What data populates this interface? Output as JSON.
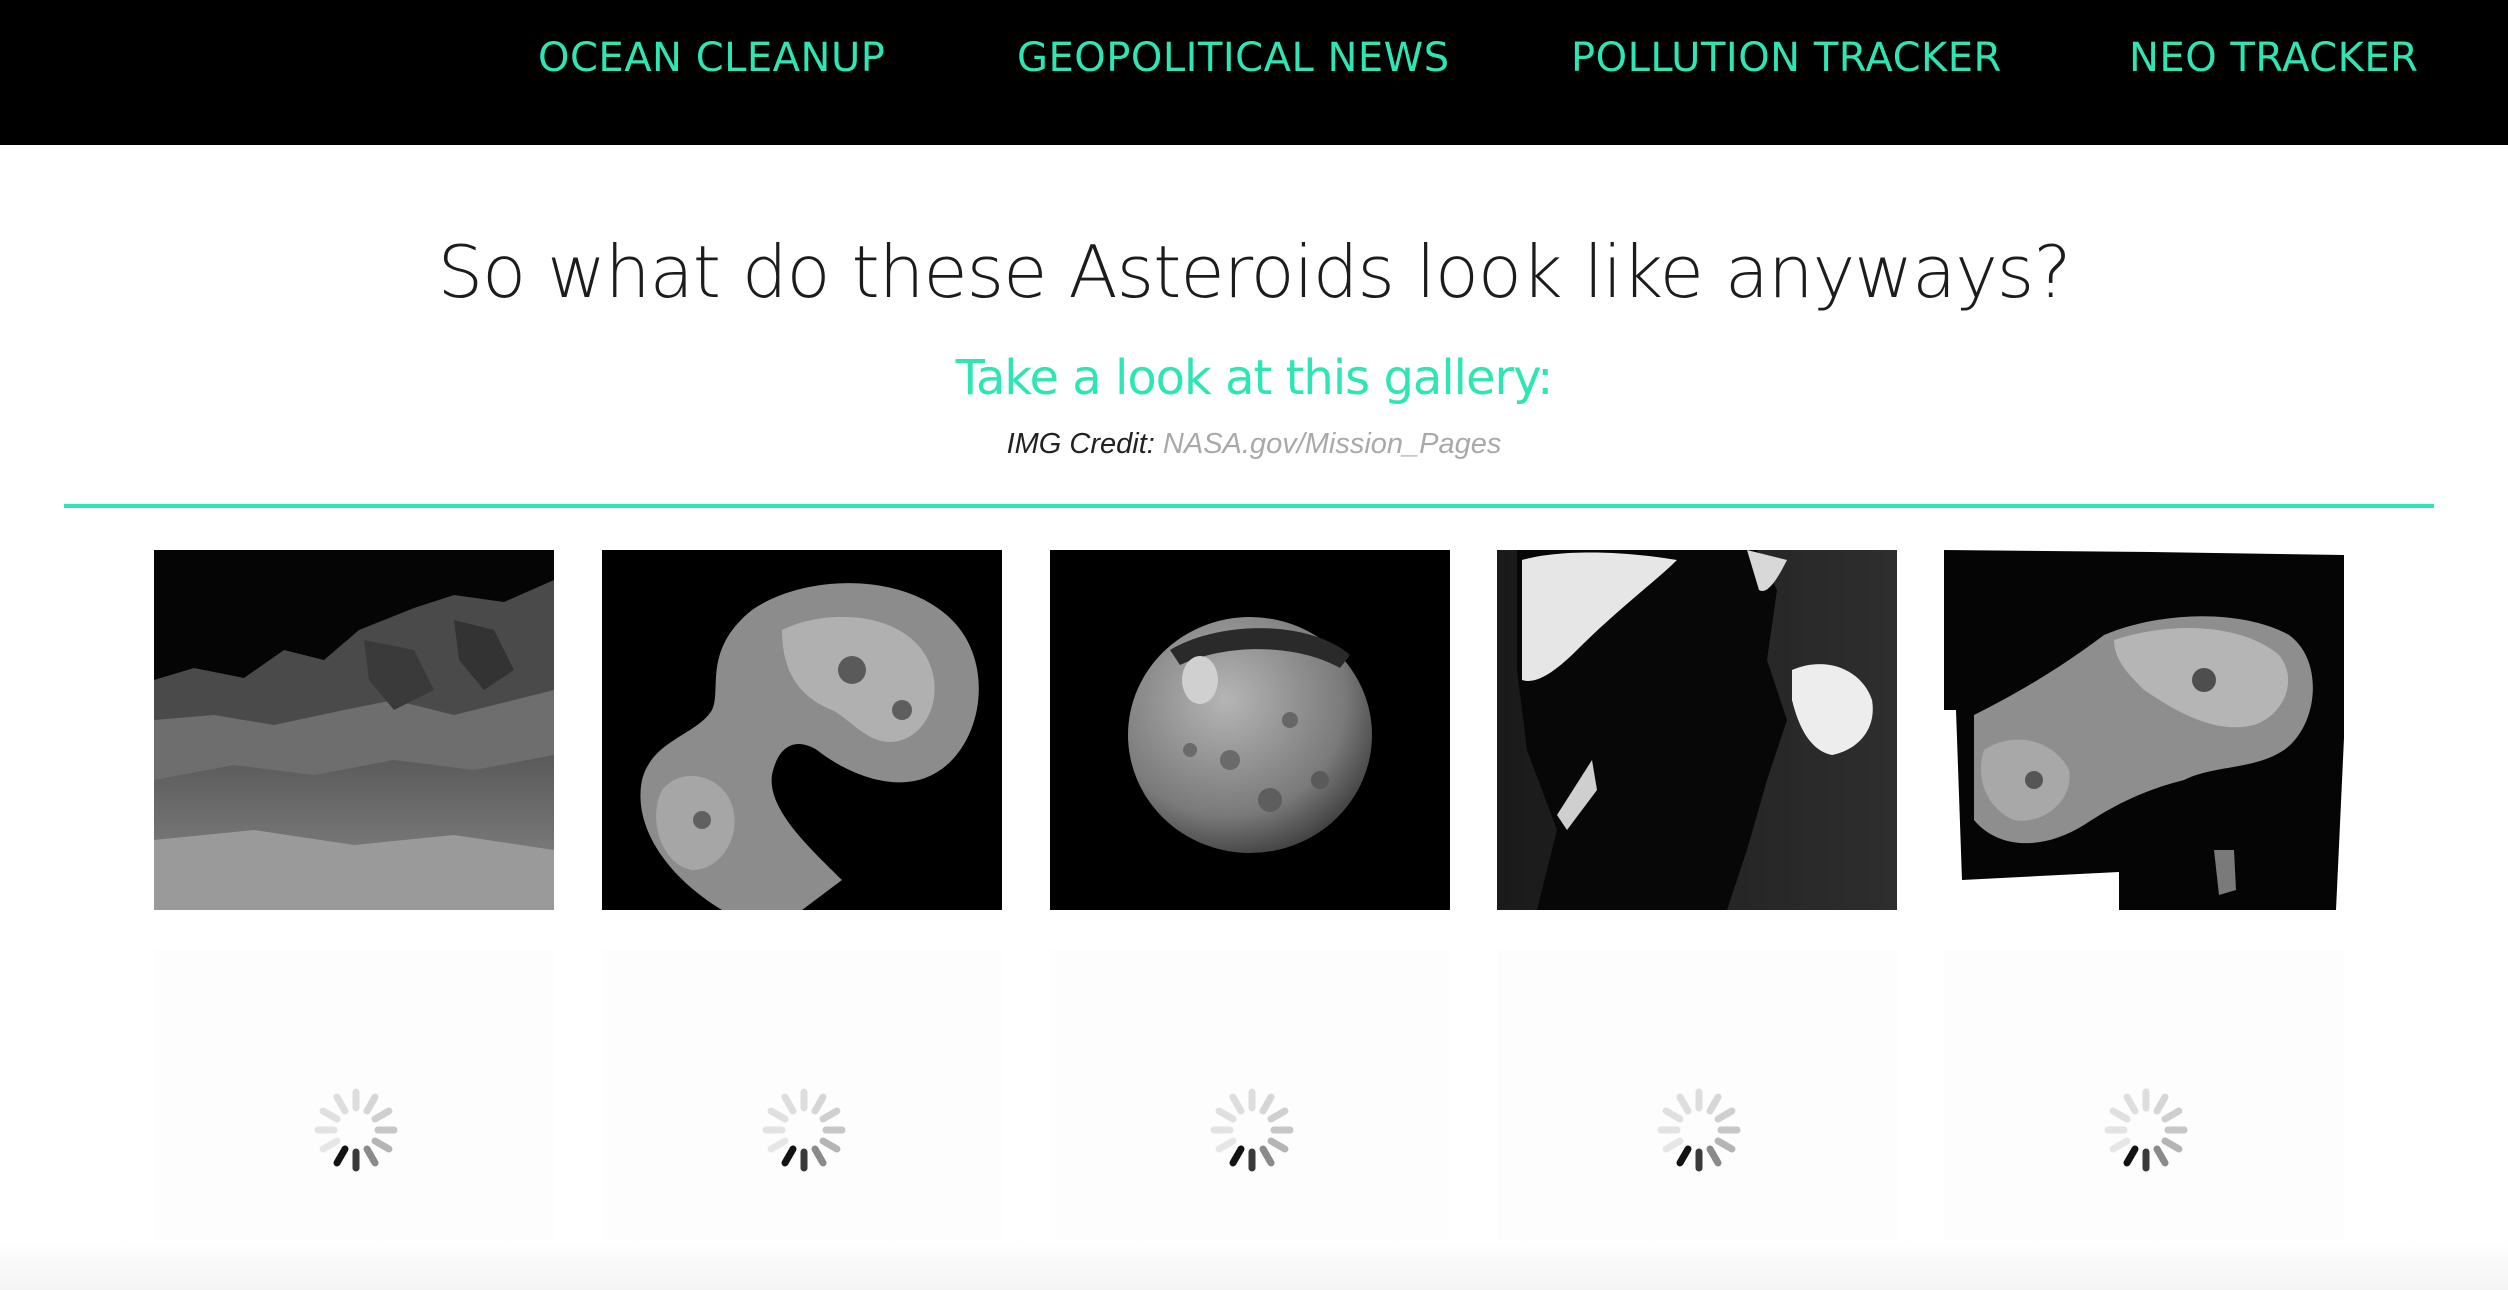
{
  "nav": {
    "items": [
      {
        "label": "OCEAN CLEANUP"
      },
      {
        "label": "GEOPOLITICAL NEWS"
      },
      {
        "label": "POLLUTION TRACKER"
      },
      {
        "label": "NEO TRACKER"
      }
    ],
    "link_color": "#2ee6b3",
    "background_color": "#000000"
  },
  "main": {
    "heading": "So what do these Asteroids look like anyways?",
    "subheading": "Take a look at this gallery:",
    "credit_label": "IMG Credit:",
    "credit_link": "NASA.gov/Mission_Pages",
    "accent_color": "#2ee6b3"
  },
  "gallery": {
    "images": [
      {
        "subject": "comet surface landscape"
      },
      {
        "subject": "curved comet nucleus"
      },
      {
        "subject": "round cratered asteroid"
      },
      {
        "subject": "backlit comet silhouette"
      },
      {
        "subject": "comet nucleus mosaic"
      }
    ],
    "loading_tiles": [
      {
        "state": "loading"
      },
      {
        "state": "loading"
      },
      {
        "state": "loading"
      },
      {
        "state": "loading"
      },
      {
        "state": "loading"
      }
    ]
  }
}
